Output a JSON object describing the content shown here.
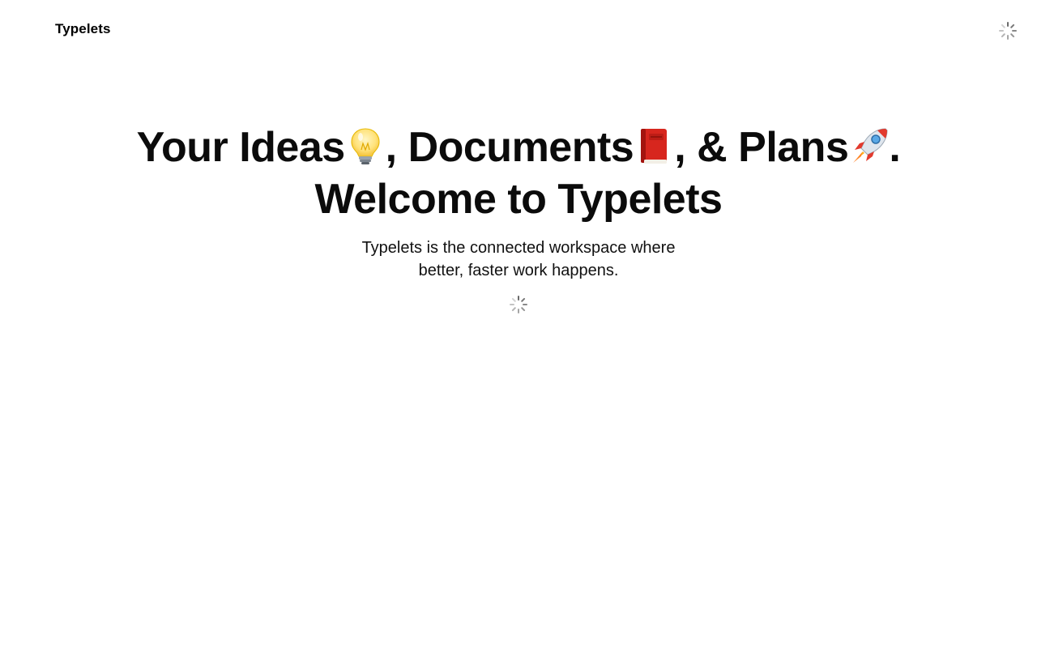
{
  "navbar": {
    "brand": "Typelets"
  },
  "hero": {
    "headline": {
      "part_ideas": "Your Ideas",
      "emoji_ideas": "light-bulb-icon",
      "part_documents": ", Documents",
      "emoji_documents": "red-book-icon",
      "part_plans": ", & Plans",
      "emoji_plans": "rocket-icon",
      "end": "."
    },
    "welcome": "Welcome to Typelets",
    "subline_1": "Typelets is the connected workspace where",
    "subline_2": "better, faster work happens."
  },
  "colors": {
    "text": "#0b0b0b",
    "background": "#ffffff",
    "spinner": "#6b6b6b"
  }
}
